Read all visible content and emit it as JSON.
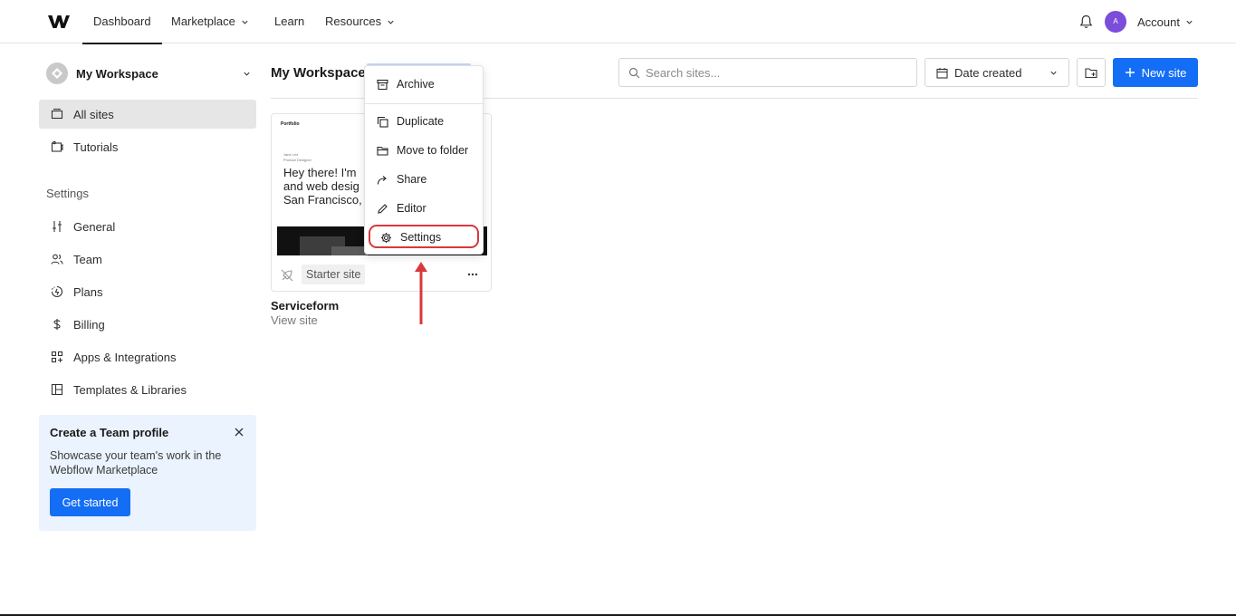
{
  "nav": {
    "dashboard": "Dashboard",
    "marketplace": "Marketplace",
    "learn": "Learn",
    "resources": "Resources",
    "avatar_initial": "A",
    "account": "Account"
  },
  "sidebar": {
    "workspace_name": "My Workspace",
    "items": [
      {
        "label": "All sites",
        "icon": "sites-icon"
      },
      {
        "label": "Tutorials",
        "icon": "tutorials-icon"
      }
    ],
    "settings_heading": "Settings",
    "settings_items": [
      {
        "label": "General",
        "icon": "sliders-icon"
      },
      {
        "label": "Team",
        "icon": "team-icon"
      },
      {
        "label": "Plans",
        "icon": "plans-icon"
      },
      {
        "label": "Billing",
        "icon": "dollar-icon"
      },
      {
        "label": "Apps & Integrations",
        "icon": "apps-icon"
      },
      {
        "label": "Templates & Libraries",
        "icon": "templates-icon"
      }
    ],
    "promo": {
      "title": "Create a Team profile",
      "text": "Showcase your team's work in the Webflow Marketplace",
      "button": "Get started"
    }
  },
  "main": {
    "title": "My Workspace",
    "search_placeholder": "Search sites...",
    "sort_label": "Date created",
    "new_site_label": "New site"
  },
  "site_card": {
    "thumb_logo": "Portfolio",
    "thumb_small_1": "Jane Lee",
    "thumb_small_2": "Product Designer",
    "thumb_hero_1": "Hey there! I'm",
    "thumb_hero_2": "and web desig",
    "thumb_hero_3": "San Francisco,",
    "badge": "Starter site",
    "name": "Serviceform",
    "view_link": "View site"
  },
  "menu": {
    "items": [
      {
        "label": "Archive",
        "icon": "archive-icon"
      },
      {
        "label": "Duplicate",
        "icon": "duplicate-icon"
      },
      {
        "label": "Move to folder",
        "icon": "folder-icon"
      },
      {
        "label": "Share",
        "icon": "share-icon"
      },
      {
        "label": "Editor",
        "icon": "pencil-icon"
      },
      {
        "label": "Settings",
        "icon": "gear-icon"
      }
    ]
  },
  "colors": {
    "accent": "#146ef5",
    "highlight": "#d9383a",
    "avatar": "#7c4dda",
    "promo_bg": "#ebf3fe"
  }
}
